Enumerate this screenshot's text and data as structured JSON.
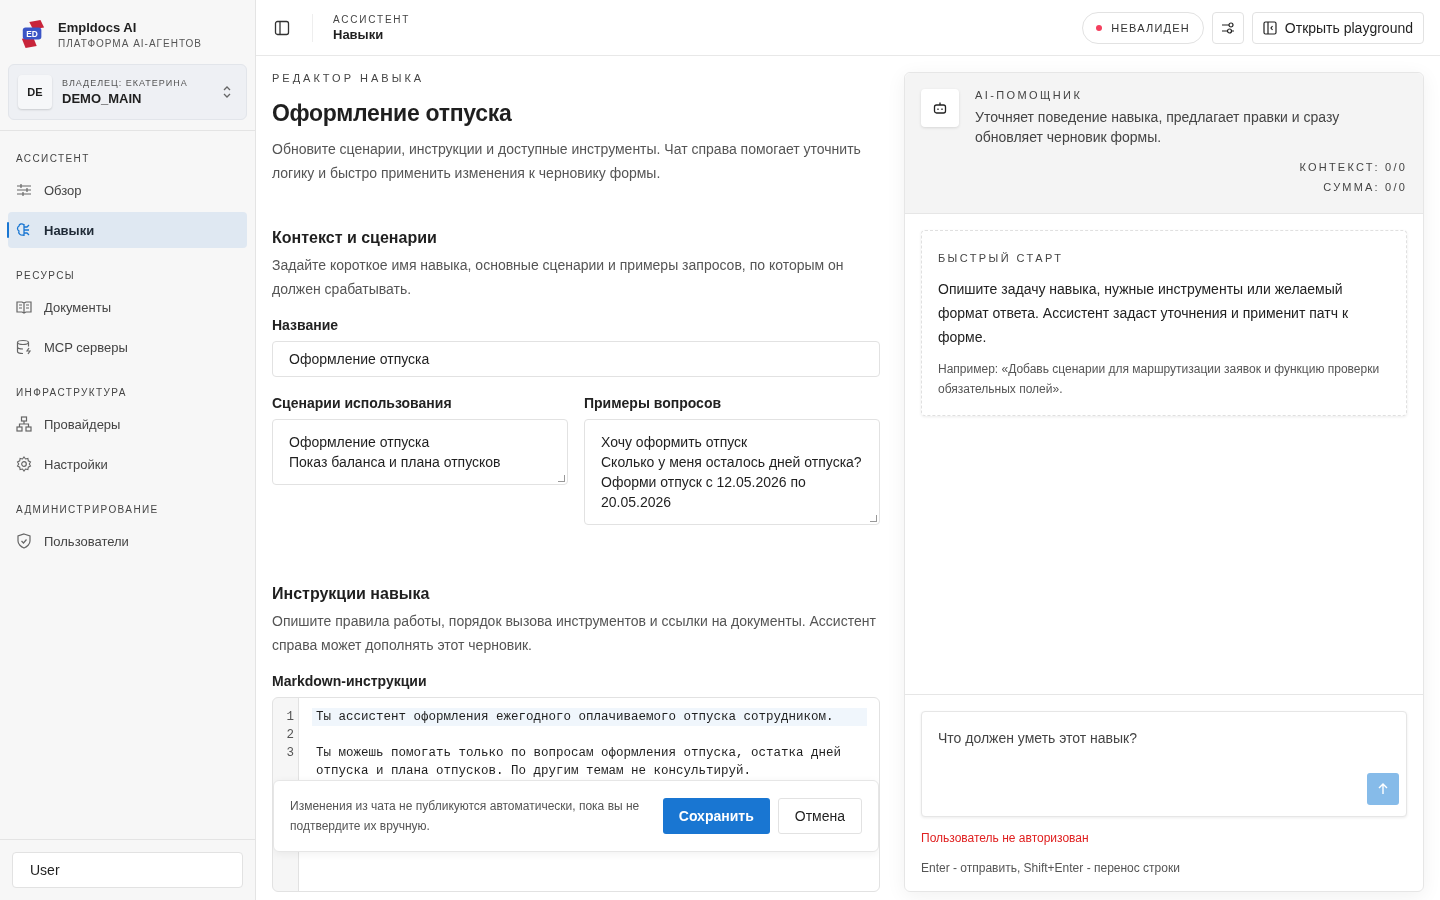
{
  "brand": {
    "name": "Empldocs AI",
    "subtitle": "ПЛАТФОРМА AI-АГЕНТОВ",
    "logo_text": "ED"
  },
  "workspace": {
    "initials": "DE",
    "owner": "ВЛАДЕЛЕЦ: ЕКАТЕРИНА",
    "name": "DEMO_MAIN"
  },
  "sidebar": {
    "sections": [
      {
        "title": "АССИСТЕНТ",
        "items": [
          {
            "label": "Обзор",
            "kind": "sliders",
            "selected": false
          },
          {
            "label": "Навыки",
            "kind": "brain",
            "selected": true
          }
        ]
      },
      {
        "title": "РЕСУРСЫ",
        "items": [
          {
            "label": "Документы",
            "kind": "book",
            "selected": false
          },
          {
            "label": "MCP серверы",
            "kind": "database",
            "selected": false
          }
        ]
      },
      {
        "title": "ИНФРАСТРУКТУРА",
        "items": [
          {
            "label": "Провайдеры",
            "kind": "network",
            "selected": false
          },
          {
            "label": "Настройки",
            "kind": "gear",
            "selected": false
          }
        ]
      },
      {
        "title": "АДМИНИСТРИРОВАНИЕ",
        "items": [
          {
            "label": "Пользователи",
            "kind": "shield",
            "selected": false
          }
        ]
      }
    ],
    "user": "User"
  },
  "header": {
    "section": "АССИСТЕНТ",
    "page": "Навыки",
    "status": {
      "label": "НЕВАЛИДЕН",
      "color": "#f43f5e"
    },
    "playground_button": "Открыть playground"
  },
  "editor": {
    "eyebrow": "РЕДАКТОР НАВЫКА",
    "title": "Оформление отпуска",
    "description": "Обновите сценарии, инструкции и доступные инструменты. Чат справа помогает уточнить логику и быстро применить изменения к черновику формы.",
    "context": {
      "title": "Контекст и сценарии",
      "description": "Задайте короткое имя навыка, основные сценарии и примеры запросов, по которым он должен срабатывать.",
      "name_label": "Название",
      "name_value": "Оформление отпуска",
      "scenarios_label": "Сценарии использования",
      "scenarios_value": "Оформление отпуска\nПоказ баланса и плана отпусков",
      "examples_label": "Примеры вопросов",
      "examples_value": "Хочу оформить отпуск\nСколько у меня осталось дней отпуска?\nОформи отпуск с 12.05.2026 по 20.05.2026"
    },
    "instructions": {
      "title": "Инструкции навыка",
      "description": "Опишите правила работы, порядок вызова инструментов и ссылки на документы. Ассистент справа может дополнять этот черновик.",
      "label": "Markdown-инструкции",
      "lines": [
        {
          "number": "1",
          "text": "Ты ассистент оформления ежегодного оплачиваемого отпуска сотрудником.",
          "selected": true
        },
        {
          "number": "2",
          "selected": false
        },
        {
          "number": "3",
          "text": "Ты можешь помогать только по вопросам оформления отпуска, остатка дней отпуска и плана отпусков. По другим темам не консультируй.",
          "selected": false
        }
      ]
    },
    "save_bar": {
      "note": "Изменения из чата не публикуются автоматически, пока вы не подтвердите их вручную.",
      "save": "Сохранить",
      "cancel": "Отмена"
    }
  },
  "assistant": {
    "eyebrow": "AI-ПОМОЩНИК",
    "description": "Уточняет поведение навыка, предлагает правки и сразу обновляет черновик формы.",
    "context": "КОНТЕКСТ: 0/0",
    "sum": "СУММА: 0/0",
    "quick_start": {
      "title": "БЫСТРЫЙ СТАРТ",
      "text": "Опишите задачу навыка, нужные инструменты или желаемый формат ответа. Ассистент задаст уточнения и применит патч к форме.",
      "example": "Например: «Добавь сценарии для маршрутизации заявок и функцию проверки обязательных полей»."
    },
    "composer": {
      "placeholder": "Что должен уметь этот навык?",
      "disabled": true
    },
    "error": "Пользователь не авторизован",
    "hint": "Enter - отправить, Shift+Enter - перенос строки"
  }
}
